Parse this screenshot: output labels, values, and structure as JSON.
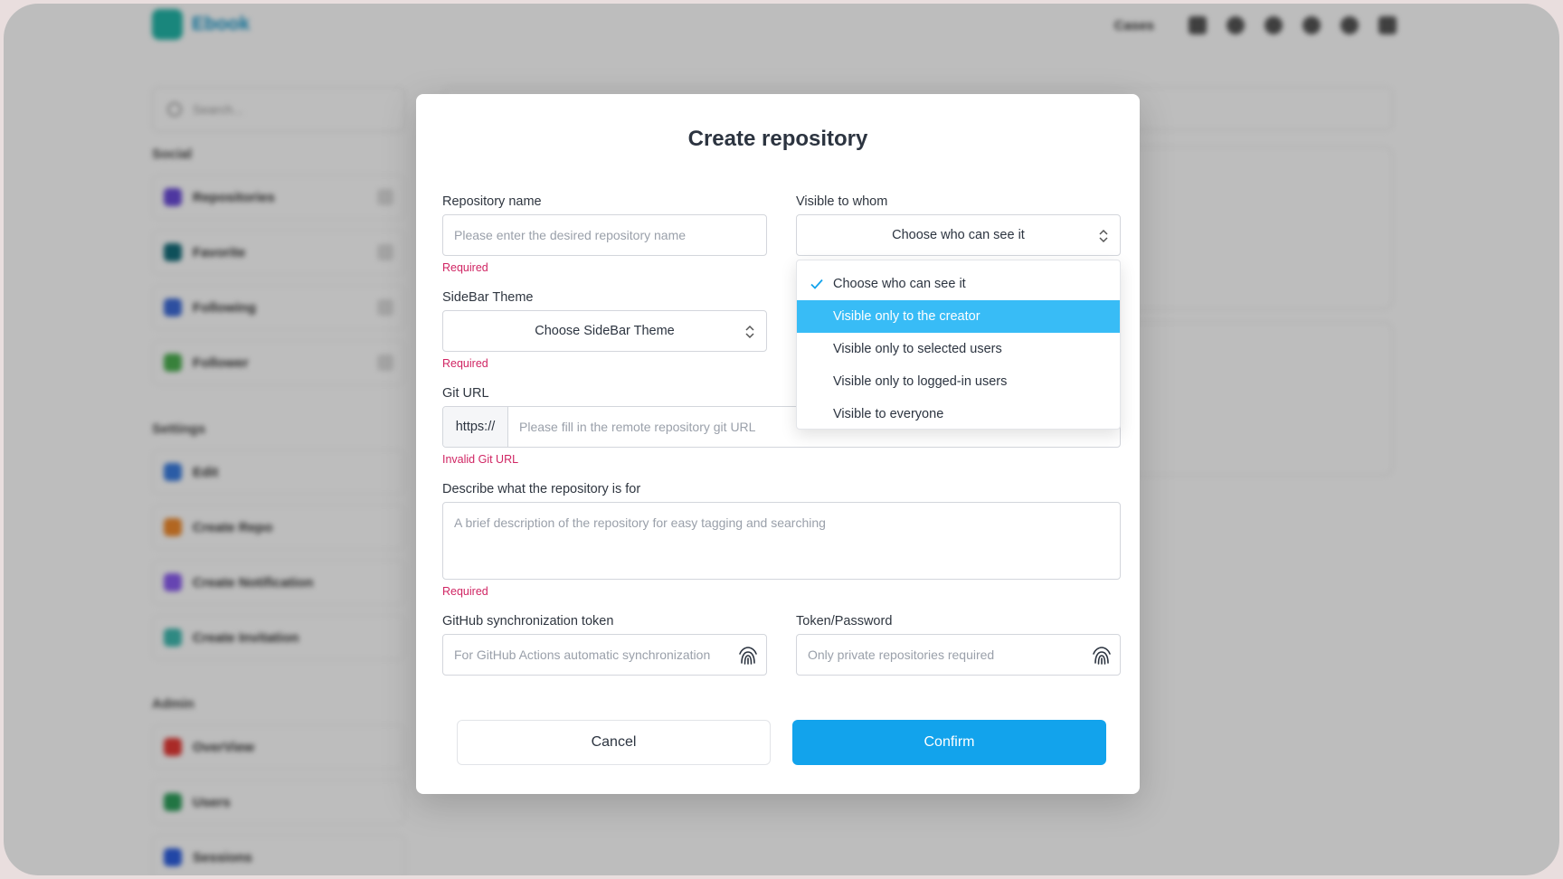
{
  "background": {
    "app_name": "Ebook",
    "header_link": "Cases",
    "search_placeholder": "Search...",
    "sections": [
      {
        "title": "Social",
        "items": [
          "Repositories",
          "Favorite",
          "Following",
          "Follower"
        ]
      },
      {
        "title": "Settings",
        "items": [
          "Edit",
          "Create Repo",
          "Create Notification",
          "Create Invitation"
        ]
      },
      {
        "title": "Admin",
        "items": [
          "OverView",
          "Users",
          "Sessions"
        ]
      }
    ],
    "item_colors": [
      "#6a4bd8",
      "#146c7a",
      "#3d6bd8",
      "#4caf50",
      "#3b7de0",
      "#f08a2c",
      "#8a5cf0",
      "#3fb9b0",
      "#e53935",
      "#2e9e5b",
      "#2d5fe0"
    ]
  },
  "dialog": {
    "title": "Create repository",
    "repo_name": {
      "label": "Repository name",
      "placeholder": "Please enter the desired repository name",
      "hint": "Required"
    },
    "visibility": {
      "label": "Visible to whom",
      "selected": "Choose who can see it",
      "options": [
        {
          "label": "Choose who can see it",
          "checked": true,
          "highlighted": false
        },
        {
          "label": "Visible only to the creator",
          "checked": false,
          "highlighted": true
        },
        {
          "label": "Visible only to selected users",
          "checked": false,
          "highlighted": false
        },
        {
          "label": "Visible only to logged-in users",
          "checked": false,
          "highlighted": false
        },
        {
          "label": "Visible to everyone",
          "checked": false,
          "highlighted": false
        }
      ]
    },
    "sidebar_theme": {
      "label": "SideBar Theme",
      "selected": "Choose SideBar Theme",
      "hint": "Required"
    },
    "git_url": {
      "label": "Git URL",
      "prefix": "https://",
      "placeholder": "Please fill in the remote repository git URL",
      "hint": "Invalid Git URL"
    },
    "description": {
      "label": "Describe what the repository is for",
      "placeholder": "A brief description of the repository for easy tagging and searching",
      "hint": "Required"
    },
    "github_token": {
      "label": "GitHub synchronization token",
      "placeholder": "For GitHub Actions automatic synchronization",
      "icon": "fingerprint-icon"
    },
    "token_password": {
      "label": "Token/Password",
      "placeholder": "Only private repositories required",
      "icon": "fingerprint-icon"
    },
    "cancel_label": "Cancel",
    "confirm_label": "Confirm"
  },
  "colors": {
    "accent": "#12a3ec",
    "highlight": "#38bcf6",
    "error": "#d02563"
  }
}
